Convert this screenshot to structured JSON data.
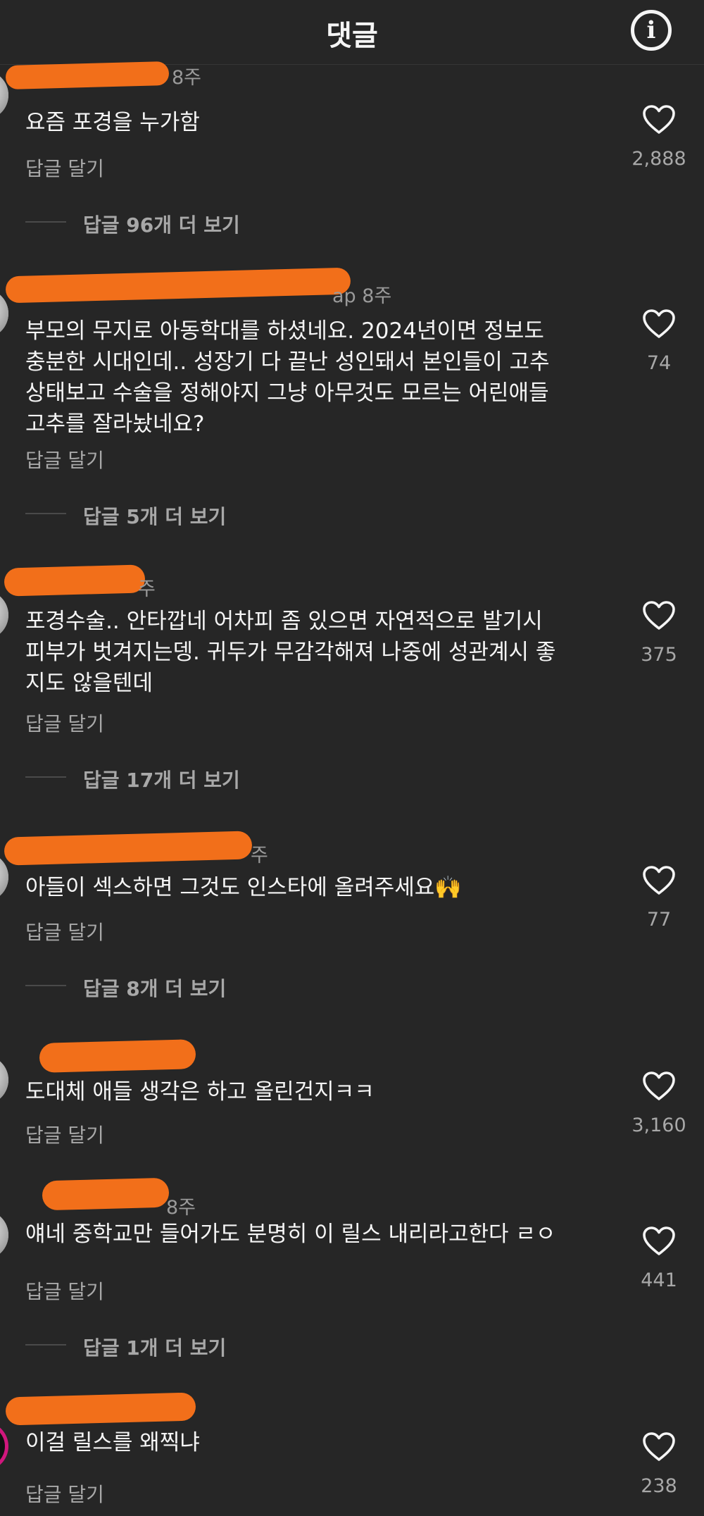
{
  "header": {
    "title": "댓글",
    "info_icon": "info-icon"
  },
  "colors": {
    "background": "#262626",
    "text": "#f5f5f5",
    "muted": "#a8a8a8",
    "redaction": "#f26f1a"
  },
  "comments": [
    {
      "meta": "8주",
      "text": "요즘 포경을 누가함",
      "reply_label": "답글 달기",
      "view_replies": "답글 96개 더 보기",
      "likes": "2,888"
    },
    {
      "meta": "ap 8주",
      "text": "부모의 무지로 아동학대를 하셨네요. 2024년이면 정보도\n충분한 시대인데.. 성장기 다 끝난 성인돼서 본인들이 고추\n상태보고 수술을 정해야지 그냥 아무것도 모르는 어린애들\n고추를 잘라놨네요?",
      "reply_label": "답글 달기",
      "view_replies": "답글 5개 더 보기",
      "likes": "74"
    },
    {
      "meta": "주",
      "text": "포경수술.. 안타깝네 어차피 좀 있으면 자연적으로 발기시\n피부가 벗겨지는뎅. 귀두가 무감각해져 나중에 성관계시 좋\n지도 않을텐데",
      "reply_label": "답글 달기",
      "view_replies": "답글 17개 더 보기",
      "likes": "375"
    },
    {
      "meta": "주",
      "text": "아들이 섹스하면 그것도 인스타에 올려주세요🙌",
      "reply_label": "답글 달기",
      "view_replies": "답글 8개 더 보기",
      "likes": "77"
    },
    {
      "meta": "",
      "text": "도대체 애들 생각은 하고 올린건지ㅋㅋ",
      "reply_label": "답글 달기",
      "view_replies": "",
      "likes": "3,160"
    },
    {
      "meta": "8주",
      "text": "얘네 중학교만 들어가도 분명히 이 릴스 내리라고한다 ㄹㅇ",
      "reply_label": "답글 달기",
      "view_replies": "답글 1개 더 보기",
      "likes": "441"
    },
    {
      "meta": "",
      "text": "이걸 릴스를 왜찍냐",
      "reply_label": "답글 달기",
      "view_replies": "",
      "likes": "238"
    }
  ]
}
